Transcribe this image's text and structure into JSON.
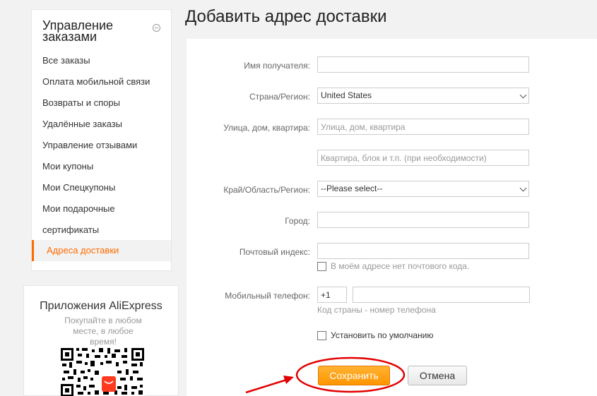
{
  "sidebar": {
    "title": "Управление заказами",
    "items": [
      {
        "label": "Все заказы"
      },
      {
        "label": "Оплата мобильной связи"
      },
      {
        "label": "Возвраты и споры"
      },
      {
        "label": "Удалённые заказы"
      },
      {
        "label": "Управление отзывами"
      },
      {
        "label": "Мои купоны"
      },
      {
        "label": "Мои Спецкупоны"
      },
      {
        "label": "Мои подарочные"
      },
      {
        "label": "сертификаты"
      },
      {
        "label": "Адреса доставки"
      }
    ],
    "active_index": 9,
    "app_title": "Приложения AliExpress",
    "app_subtitle": "Покупайте в любом месте, в любое время!",
    "qr_logo_text": "AliExpress"
  },
  "page_title": "Добавить адрес доставки",
  "form": {
    "recipient_label": "Имя получателя:",
    "recipient_value": "",
    "country_label": "Страна/Регион:",
    "country_value": "United States",
    "street_label": "Улица, дом, квартира:",
    "street_placeholder": "Улица, дом, квартира",
    "apt_placeholder": "Квартира, блок и т.п. (при необходимости)",
    "region_label": "Край/Область/Регион:",
    "region_value": "--Please select--",
    "city_label": "Город:",
    "city_value": "",
    "zip_label": "Почтовый индекс:",
    "zip_value": "",
    "no_zip_label": "В моём адресе нет почтового кода.",
    "phone_label": "Мобильный телефон:",
    "phone_code": "+1",
    "phone_value": "",
    "phone_hint": "Код страны - номер телефона",
    "default_label": "Установить по умолчанию",
    "save_label": "Сохранить",
    "cancel_label": "Отмена"
  },
  "colors": {
    "accent": "#ff6a00",
    "save_button": "#ff9c1a",
    "annotation": "#e30000"
  }
}
